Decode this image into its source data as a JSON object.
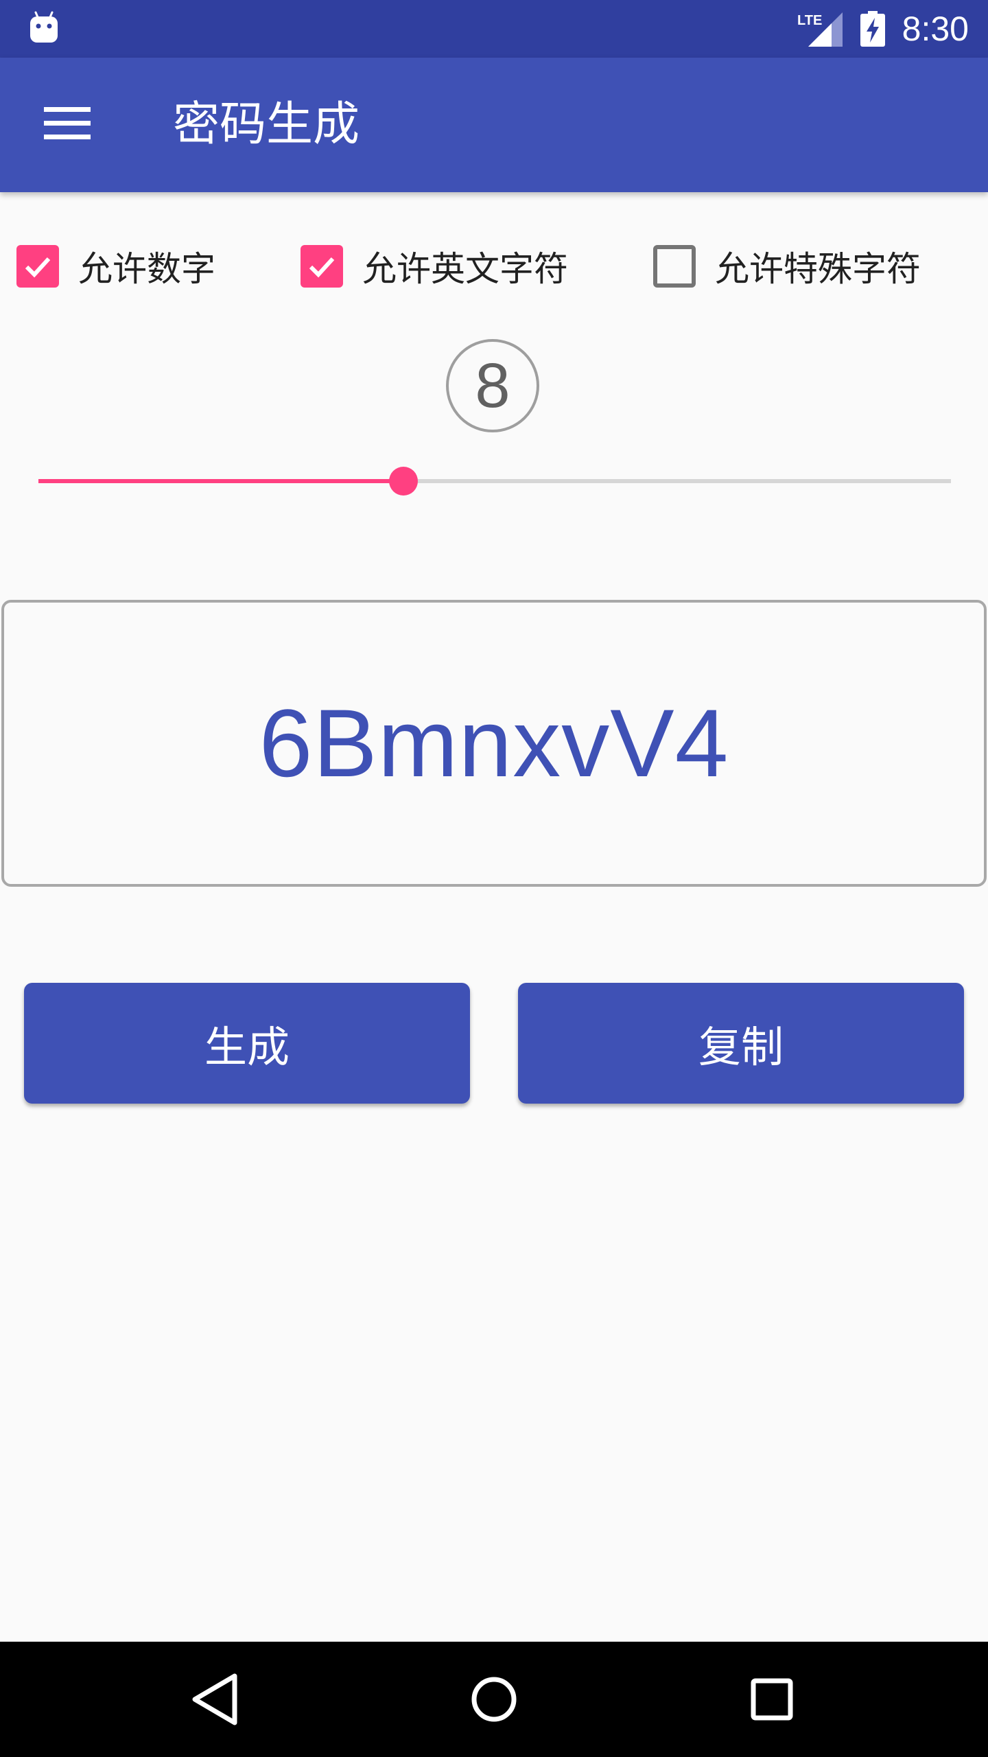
{
  "status_bar": {
    "time": "8:30",
    "network": "LTE",
    "icons": [
      "android-icon",
      "lte-signal-icon",
      "battery-charging-icon"
    ]
  },
  "app_bar": {
    "title": "密码生成",
    "menu_icon": "hamburger-menu-icon"
  },
  "options": [
    {
      "label": "允许数字",
      "checked": true
    },
    {
      "label": "允许英文字符",
      "checked": true
    },
    {
      "label": "允许特殊字符",
      "checked": false
    }
  ],
  "length": {
    "value": "8",
    "slider_fraction": 0.4
  },
  "password": "6BmnxvV4",
  "buttons": {
    "generate": "生成",
    "copy": "复制"
  },
  "nav_bar": {
    "icons": [
      "back-icon",
      "home-icon",
      "recents-icon"
    ]
  },
  "colors": {
    "primary": "#3f51b5",
    "primary_dark": "#303f9f",
    "accent": "#ff4081"
  }
}
